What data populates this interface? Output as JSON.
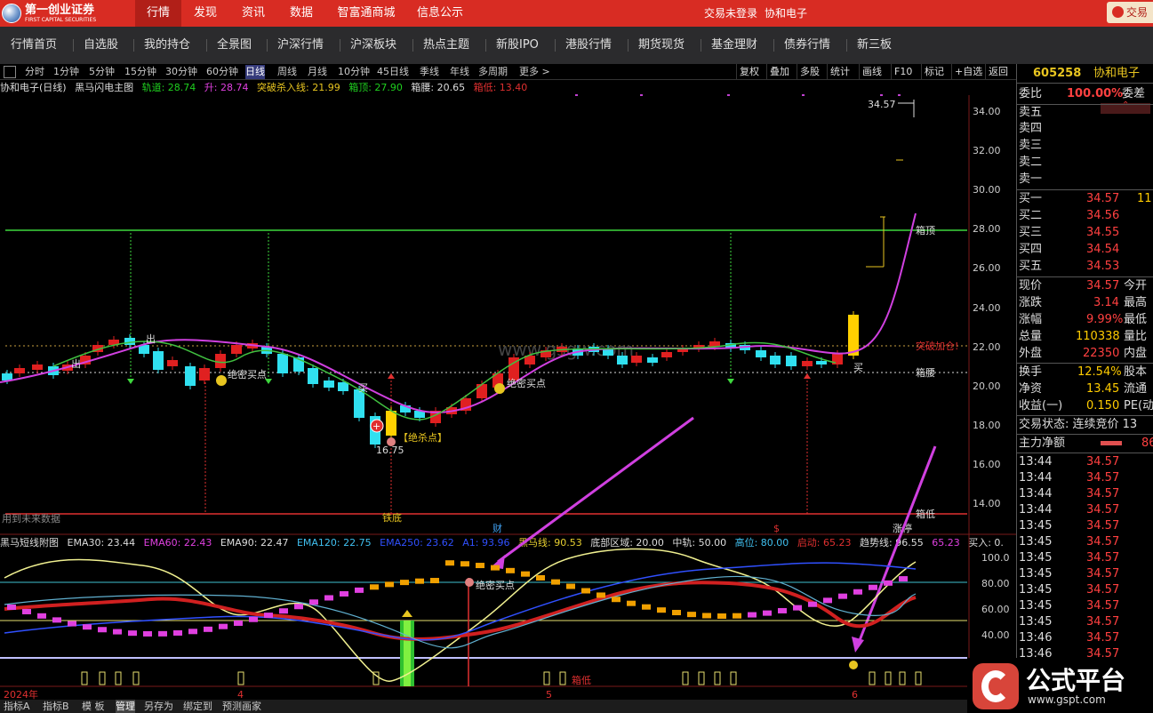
{
  "top_nav": {
    "logo_cn": "第一创业证券",
    "logo_en": "FIRST CAPITAL SECURITIES",
    "items": [
      "行情",
      "发现",
      "资讯",
      "数据",
      "智富通商城",
      "信息公示"
    ],
    "login": "交易未登录",
    "stock": "协和电子",
    "corner": "交易"
  },
  "nav": [
    "行情首页",
    "自选股",
    "我的持仓",
    "全景图",
    "沪深行情",
    "沪深板块",
    "热点主题",
    "新股IPO",
    "港股行情",
    "期货现货",
    "基金理财",
    "债券行情",
    "新三板"
  ],
  "toolbar": {
    "left": [
      "分时",
      "1分钟",
      "5分钟",
      "15分钟",
      "30分钟",
      "60分钟",
      "日线",
      "周线",
      "月线",
      "10分钟",
      "45日线",
      "季线",
      "年线",
      "多周期",
      "更多 >"
    ],
    "right": [
      "复权",
      "叠加",
      "多股",
      "统计",
      "画线",
      "F10",
      "标记",
      "+自选",
      "返回"
    ]
  },
  "main_info": {
    "title": "协和电子(日线)",
    "indicator": "黑马闪电主图",
    "gd": "轨道: 28.74",
    "sheng": "升: 28.74",
    "tp": "突破杀入线: 21.99",
    "xd": "箱顶: 27.90",
    "xy": "箱腰: 20.65",
    "xdi": "箱低: 13.40"
  },
  "sub_info": {
    "title": "黑马短线附图",
    "ema30": "EMA30: 23.44",
    "ema60": "EMA60: 22.43",
    "ema90": "EMA90: 22.47",
    "ema120": "EMA120: 22.75",
    "ema250": "EMA250: 23.62",
    "a1": "A1: 93.96",
    "hm": "黑马线: 90.53",
    "db": "底部区域: 20.00",
    "zg": "中轨: 50.00",
    "gw": "高位: 80.00",
    "qd": "启动: 65.23",
    "qs": "趋势线: 96.55",
    "v": "65.23",
    "mr": "买入: 0."
  },
  "side": {
    "code": "605258",
    "name": "协和电子",
    "weibi_label": "委比",
    "weibi": "100.00%",
    "weicha": "委差",
    "sells": [
      "卖五",
      "卖四",
      "卖三",
      "卖二",
      "卖一"
    ],
    "buys": [
      {
        "l": "买一",
        "p": "34.57",
        "v": "11"
      },
      {
        "l": "买二",
        "p": "34.56",
        "v": ""
      },
      {
        "l": "买三",
        "p": "34.55",
        "v": ""
      },
      {
        "l": "买四",
        "p": "34.54",
        "v": ""
      },
      {
        "l": "买五",
        "p": "34.53",
        "v": ""
      }
    ],
    "stats": [
      {
        "l": "现价",
        "v": "34.57",
        "r": "今开"
      },
      {
        "l": "涨跌",
        "v": "3.14",
        "r": "最高"
      },
      {
        "l": "涨幅",
        "v": "9.99%",
        "r": "最低"
      },
      {
        "l": "总量",
        "v": "110338",
        "r": "量比"
      },
      {
        "l": "外盘",
        "v": "22350",
        "r": "内盘"
      },
      {
        "l": "换手",
        "v": "12.54%",
        "r": "股本"
      },
      {
        "l": "净资",
        "v": "13.45",
        "r": "流通"
      },
      {
        "l": "收益(一)",
        "v": "0.150",
        "r": "PE(动"
      }
    ],
    "trade_state": "交易状态: 连续竞价 13",
    "main_flow": "主力净额",
    "main_flow_v": "86",
    "ticks": [
      {
        "t": "13:44",
        "p": "34.57"
      },
      {
        "t": "13:44",
        "p": "34.57"
      },
      {
        "t": "13:44",
        "p": "34.57"
      },
      {
        "t": "13:44",
        "p": "34.57"
      },
      {
        "t": "13:45",
        "p": "34.57"
      },
      {
        "t": "13:45",
        "p": "34.57"
      },
      {
        "t": "13:45",
        "p": "34.57"
      },
      {
        "t": "13:45",
        "p": "34.57"
      },
      {
        "t": "13:45",
        "p": "34.57"
      },
      {
        "t": "13:45",
        "p": "34.57"
      },
      {
        "t": "13:45",
        "p": "34.57"
      },
      {
        "t": "13:46",
        "p": "34.57"
      },
      {
        "t": "13:46",
        "p": "34.57"
      }
    ]
  },
  "axis": {
    "y_main": [
      "34.00",
      "32.00",
      "30.00",
      "28.00",
      "26.00",
      "24.00",
      "22.00",
      "20.00",
      "18.00",
      "16.00",
      "14.00"
    ],
    "y_sub": [
      "100.0",
      "80.00",
      "60.00",
      "40.00"
    ],
    "x": [
      "2024年",
      "4",
      "5",
      "6"
    ]
  },
  "labels": {
    "price_top": "34.57",
    "xiangding": "箱顶",
    "tupo": "突破加仓!",
    "xiangyao": "箱腰",
    "xiangdi": "箱低",
    "jmmd1": "绝密买点",
    "jmmd2": "绝密买点",
    "jmmd3": "绝密买点",
    "mai": "买",
    "mai2": "买",
    "chu": "出",
    "chu2": "出",
    "jsd": "【绝杀点】",
    "low": "16.75",
    "tiedi": "铁底",
    "cai": "财",
    "dollar": "$",
    "zhangting": "涨停",
    "weilai": "用到未来数据",
    "xiangdi_sub": "箱低",
    "web": "www.gsgw.com"
  },
  "bottom": [
    "指标A",
    "指标B",
    "模 板",
    "管理",
    "另存为",
    "绑定到",
    "预测画家"
  ],
  "watermark": {
    "title": "公式平台",
    "url": "www.gspt.com"
  }
}
